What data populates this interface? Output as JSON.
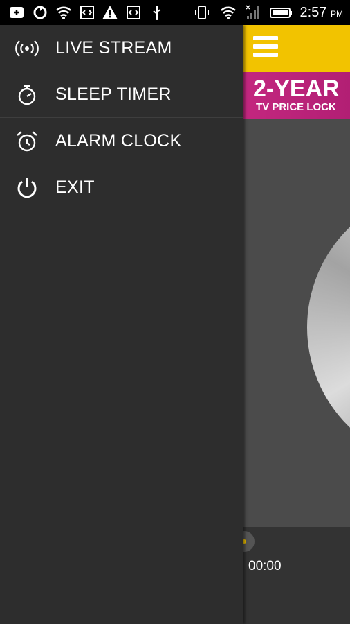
{
  "status_bar": {
    "time": "2:57",
    "ampm": "PM",
    "icons": [
      "add-notification-icon",
      "sync-icon",
      "wifi-icon",
      "code-icon",
      "warning-icon",
      "code-icon",
      "usb-icon",
      "vibrate-icon",
      "wifi-icon",
      "signal-icon",
      "battery-icon"
    ]
  },
  "drawer": {
    "items": [
      {
        "label": "LIVE STREAM",
        "icon": "broadcast-icon"
      },
      {
        "label": "SLEEP TIMER",
        "icon": "stopwatch-icon"
      },
      {
        "label": "ALARM CLOCK",
        "icon": "alarm-clock-icon"
      },
      {
        "label": "EXIT",
        "icon": "power-icon"
      }
    ]
  },
  "app": {
    "header_color": "#f2c300",
    "promo": {
      "line1": "2-YEAR",
      "line2": "TV PRICE LOCK",
      "color": "#c3277f"
    },
    "player": {
      "time": "00:00"
    }
  }
}
